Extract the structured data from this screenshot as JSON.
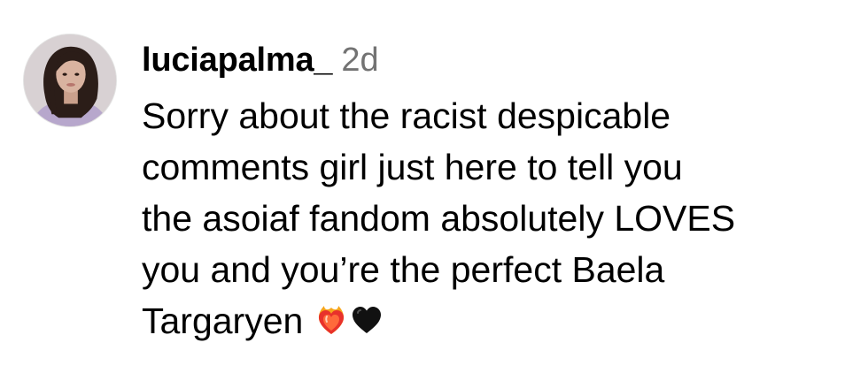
{
  "comment": {
    "username": "luciapalma_",
    "timestamp": "2d",
    "lines": [
      "Sorry about the racist despicable",
      "comments girl just here to tell you",
      "the asoiaf fandom absolutely LOVES",
      "you and you’re the perfect Baela",
      "Targaryen "
    ],
    "emojis": [
      "heart-on-fire-icon",
      "black-heart-icon"
    ]
  },
  "colors": {
    "username": "#000000",
    "timestamp": "#737373",
    "background": "#ffffff"
  }
}
